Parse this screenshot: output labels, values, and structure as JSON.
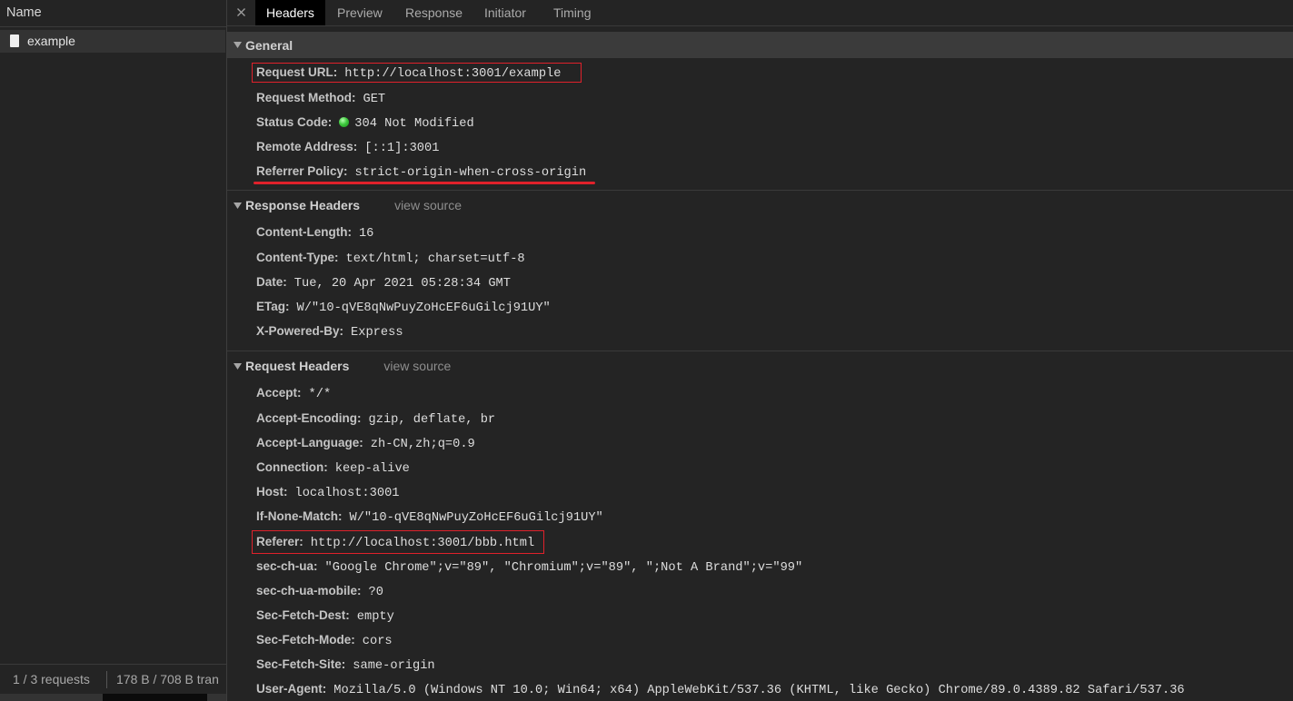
{
  "colors": {
    "background": "#242424",
    "selected_row_bg": "#333333",
    "section_header_bg": "#3b3b3b",
    "status_ok": "#3ec93e",
    "annotation_red": "#e0212b"
  },
  "network_list": {
    "column_header": "Name",
    "requests": [
      {
        "name": "example",
        "icon": "document-icon",
        "selected": true
      }
    ],
    "summary": {
      "requests": "1 / 3 requests",
      "transferred": "178 B / 708 B tran"
    }
  },
  "details": {
    "close_icon": "close-icon",
    "tabs": [
      {
        "label": "Headers",
        "active": true
      },
      {
        "label": "Preview",
        "active": false
      },
      {
        "label": "Response",
        "active": false
      },
      {
        "label": "Initiator",
        "active": false
      },
      {
        "label": "Timing",
        "active": false
      }
    ],
    "general": {
      "title": "General",
      "expanded": true,
      "rows": [
        {
          "key": "Request URL:",
          "value": "http://localhost:3001/example",
          "annotated": true
        },
        {
          "key": "Request Method:",
          "value": "GET"
        },
        {
          "key": "Status Code:",
          "value": "304 Not Modified",
          "status_icon": "status-dot-icon"
        },
        {
          "key": "Remote Address:",
          "value": "[::1]:3001"
        },
        {
          "key": "Referrer Policy:",
          "value": "strict-origin-when-cross-origin",
          "annotated": true
        }
      ]
    },
    "response_headers": {
      "title": "Response Headers",
      "expanded": true,
      "view_source_label": "view source",
      "rows": [
        {
          "key": "Content-Length:",
          "value": "16"
        },
        {
          "key": "Content-Type:",
          "value": "text/html; charset=utf-8"
        },
        {
          "key": "Date:",
          "value": "Tue, 20 Apr 2021 05:28:34 GMT"
        },
        {
          "key": "ETag:",
          "value": "W/\"10-qVE8qNwPuyZoHcEF6uGilcj91UY\""
        },
        {
          "key": "X-Powered-By:",
          "value": "Express"
        }
      ]
    },
    "request_headers": {
      "title": "Request Headers",
      "expanded": true,
      "view_source_label": "view source",
      "rows": [
        {
          "key": "Accept:",
          "value": "*/*"
        },
        {
          "key": "Accept-Encoding:",
          "value": "gzip, deflate, br"
        },
        {
          "key": "Accept-Language:",
          "value": "zh-CN,zh;q=0.9"
        },
        {
          "key": "Connection:",
          "value": "keep-alive"
        },
        {
          "key": "Host:",
          "value": "localhost:3001"
        },
        {
          "key": "If-None-Match:",
          "value": "W/\"10-qVE8qNwPuyZoHcEF6uGilcj91UY\""
        },
        {
          "key": "Referer:",
          "value": "http://localhost:3001/bbb.html",
          "annotated": true
        },
        {
          "key": "sec-ch-ua:",
          "value": "\"Google Chrome\";v=\"89\", \"Chromium\";v=\"89\", \";Not A Brand\";v=\"99\""
        },
        {
          "key": "sec-ch-ua-mobile:",
          "value": "?0"
        },
        {
          "key": "Sec-Fetch-Dest:",
          "value": "empty"
        },
        {
          "key": "Sec-Fetch-Mode:",
          "value": "cors"
        },
        {
          "key": "Sec-Fetch-Site:",
          "value": "same-origin"
        },
        {
          "key": "User-Agent:",
          "value": "Mozilla/5.0 (Windows NT 10.0; Win64; x64) AppleWebKit/537.36 (KHTML, like Gecko) Chrome/89.0.4389.82 Safari/537.36"
        }
      ]
    }
  }
}
